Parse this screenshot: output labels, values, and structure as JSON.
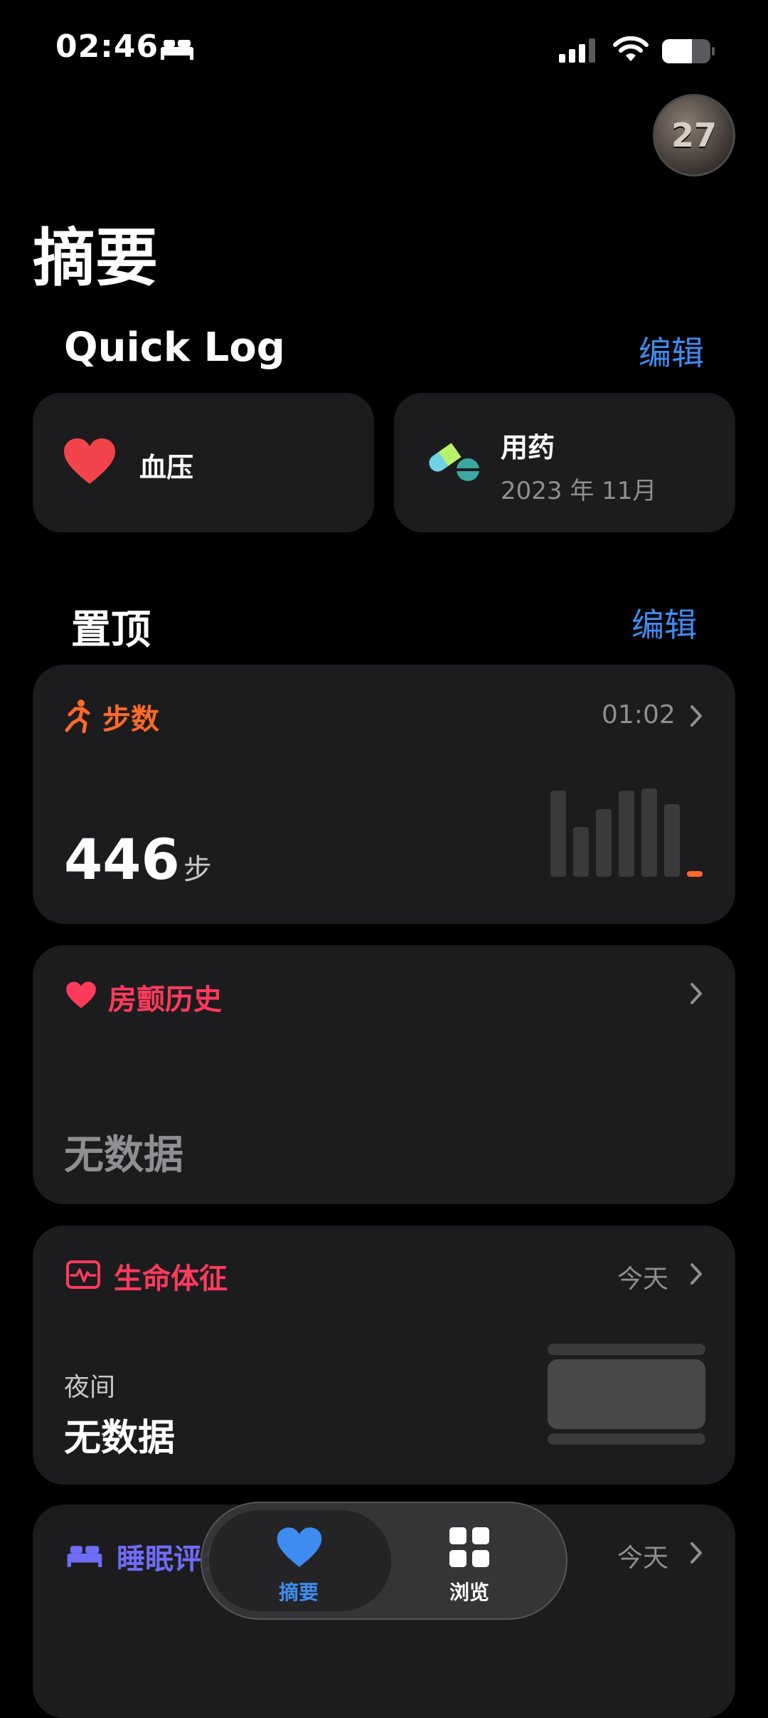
{
  "status": {
    "time": "02:46"
  },
  "avatar": {
    "text": "27"
  },
  "page": {
    "title": "摘要"
  },
  "quick_log": {
    "title": "Quick Log",
    "edit": "编辑",
    "items": [
      {
        "label": "血压",
        "icon": "heart-icon"
      },
      {
        "label": "用药",
        "sub": "2023 年 11月",
        "icon": "pill-icon"
      }
    ]
  },
  "pinned": {
    "title": "置顶",
    "edit": "编辑",
    "steps": {
      "title": "步数",
      "time": "01:02",
      "value": "446",
      "unit": "步",
      "bars": [
        0.88,
        0.51,
        0.69,
        0.88,
        0.9,
        0.74,
        0.06
      ],
      "color": "#ff6a2a"
    },
    "afib": {
      "title": "房颤历史",
      "value": "无数据",
      "color": "#ff3b5c"
    },
    "vitals": {
      "title": "生命体征",
      "time": "今天",
      "sub": "夜间",
      "value": "无数据",
      "color": "#ff3b5c"
    },
    "sleep": {
      "title": "睡眠评分",
      "time": "今天",
      "color": "#6f6cf6"
    }
  },
  "tabbar": {
    "tabs": [
      {
        "label": "摘要",
        "icon": "heart-icon",
        "active": true
      },
      {
        "label": "浏览",
        "icon": "grid-icon",
        "active": false
      }
    ]
  },
  "colors": {
    "accent": "#3f8cf0",
    "card": "#1c1c1e"
  }
}
